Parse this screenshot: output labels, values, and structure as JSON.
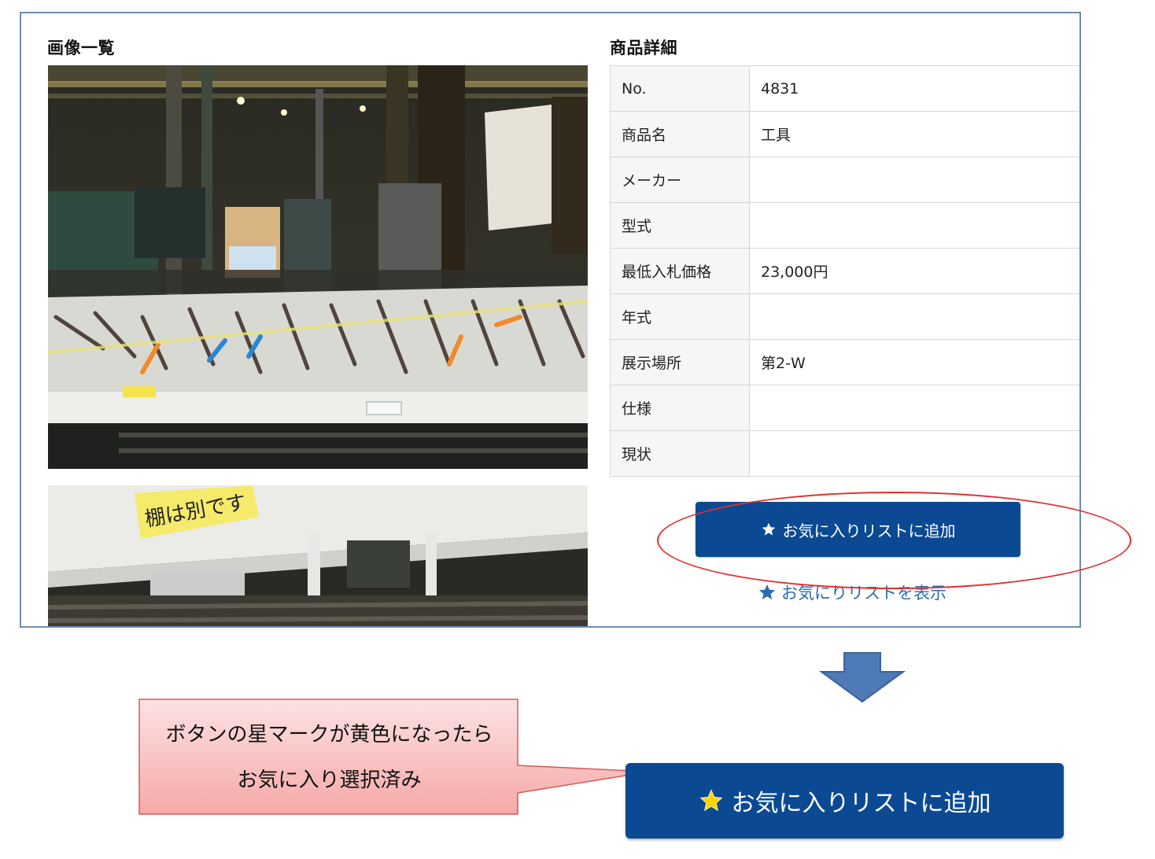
{
  "images_section": {
    "title": "画像一覧"
  },
  "details_section": {
    "title": "商品詳細",
    "rows": [
      {
        "label": "No.",
        "value": "4831"
      },
      {
        "label": "商品名",
        "value": "工具"
      },
      {
        "label": "メーカー",
        "value": ""
      },
      {
        "label": "型式",
        "value": ""
      },
      {
        "label": "最低入札価格",
        "value": "23,000円"
      },
      {
        "label": "年式",
        "value": ""
      },
      {
        "label": "展示場所",
        "value": "第2-W"
      },
      {
        "label": "仕様",
        "value": ""
      },
      {
        "label": "現状",
        "value": ""
      }
    ]
  },
  "actions": {
    "add_favorite_label": "お気に入りリストに追加",
    "show_favorites_label": "お気にりリストを表示"
  },
  "annotation": {
    "line1": "ボタンの星マークが黄色になったら",
    "line2": "お気に入り選択済み"
  },
  "selected_button": {
    "label": "お気に入りリストに追加"
  },
  "colors": {
    "button_bg": "#0b4a93",
    "frame_border": "#6d8db7",
    "highlight_ellipse": "#e03030",
    "link": "#2b6cb0",
    "star_default": "#ffffff",
    "star_selected": "#ffd400",
    "callout_fill": "#f9b2b2"
  },
  "icons": {
    "button_star": "star-icon",
    "link_star": "star-icon",
    "arrow": "down-arrow-icon"
  }
}
